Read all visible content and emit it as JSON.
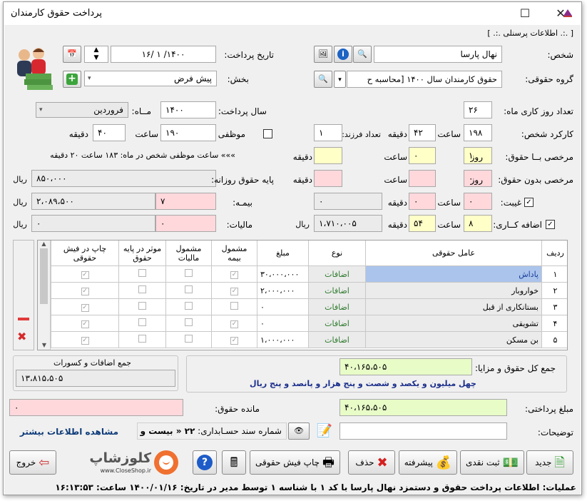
{
  "window": {
    "title": "پرداخت حقوق کارمندان"
  },
  "section": {
    "personnel_info": "[ .:. اطلاعات پرسنلی .:. ]"
  },
  "person": {
    "label": "شخص:",
    "value": "نهال پارسا"
  },
  "salary_group": {
    "label": "گروه حقوقی:",
    "value": "حقوق کارمندان سال ۱۴۰۰ [محاسبه ح"
  },
  "payment_date": {
    "label": "تاریخ پرداخت:",
    "value": "۱۴۰۰/ ۱ /۱۶"
  },
  "section_field": {
    "label": "بخش:",
    "value": "پیش فرض"
  },
  "work_days": {
    "label": "تعداد روز کاری ماه:",
    "value": "۲۶"
  },
  "pay_year": {
    "label": "سال پرداخت:",
    "value": "۱۴۰۰"
  },
  "month": {
    "label": "مــاه:",
    "value": "فروردین"
  },
  "mandatory": {
    "label": "موظفی ماه:",
    "hours": "۱۹۰",
    "hours_unit": "ساعت",
    "minutes": "۴۰",
    "minutes_unit": "دقیقه",
    "note": "»»» ساعت موظفی شخص در ماه: ۱۸۳ ساعت ۲۰ دقیقه"
  },
  "performance": {
    "label": "کارکرد شخص:",
    "hours": "۱۹۸",
    "hours_unit": "ساعت",
    "minutes": "۴۲",
    "minutes_unit": "دقیقه",
    "children_label": "تعداد فرزند:",
    "children": "۱"
  },
  "paid_leave": {
    "label": "مرخصی بــا حقوق:",
    "days": "۱",
    "days_unit": "روز",
    "hours": "۰",
    "hours_unit": "ساعت",
    "minutes": "",
    "minutes_unit": "دقیقه"
  },
  "unpaid_leave": {
    "label": "مرخصی بدون حقوق:",
    "days": "۰",
    "days_unit": "روز",
    "hours": "",
    "hours_unit": "ساعت",
    "minutes": "",
    "minutes_unit": "دقیقه"
  },
  "absence": {
    "label": "غیبت:",
    "hours": "۰",
    "hours_unit": "ساعت",
    "minutes": "۰",
    "minutes_unit": "دقیقه",
    "amount": "۰"
  },
  "overtime": {
    "label": "اضافه کــاری:",
    "hours": "۸",
    "hours_unit": "ساعت",
    "minutes": "۵۴",
    "minutes_unit": "دقیقه",
    "amount": "۱،۷۱۰،۰۰۵",
    "currency": "ریال"
  },
  "daily_base": {
    "label": "پایه حقوق روزانه:",
    "value": "۸۵۰،۰۰۰",
    "currency": "ریال"
  },
  "insurance": {
    "label": "بیمـه:",
    "percent": "۷",
    "amount": "۲،۰۸۹،۵۰۰",
    "currency": "ریال"
  },
  "tax": {
    "label": "مالیات:",
    "percent": "۰",
    "amount": "۰",
    "currency": "ریال"
  },
  "table": {
    "headers": [
      "ردیف",
      "عامل حقوقی",
      "نوع",
      "مبلغ",
      "مشمول بیمه",
      "مشمول مالیات",
      "موثر در پایه حقوق",
      "چاپ در فیش حقوقی"
    ],
    "rows": [
      {
        "row": "۱",
        "factor": "پاداش",
        "type": "اضافات",
        "amount": "۳۰،۰۰۰،۰۰۰",
        "insurance": true,
        "tax": false,
        "base": false,
        "print": true
      },
      {
        "row": "۲",
        "factor": "خواروبار",
        "type": "اضافات",
        "amount": "۲،۰۰۰،۰۰۰",
        "insurance": true,
        "tax": false,
        "base": false,
        "print": true
      },
      {
        "row": "۳",
        "factor": "بستانکاری از قبل",
        "type": "اضافات",
        "amount": "۰",
        "insurance": false,
        "tax": false,
        "base": false,
        "print": true
      },
      {
        "row": "۴",
        "factor": "تشویقی",
        "type": "اضافات",
        "amount": "۰",
        "insurance": true,
        "tax": false,
        "base": false,
        "print": true
      },
      {
        "row": "۵",
        "factor": "بن مسکن",
        "type": "اضافات",
        "amount": "۱،۰۰۰،۰۰۰",
        "insurance": true,
        "tax": false,
        "base": false,
        "print": true
      }
    ]
  },
  "totals": {
    "sum_label": "جمع اضافات و کسورات",
    "sum_value": "۱۳،۸۱۵،۵۰۵",
    "total_label": "جمع کل حقوق و مزایا:",
    "total_value": "۴۰،۱۶۵،۵۰۵",
    "total_words": "چهل میلیون و یکصد و شصت و پنج هزار و پانصد و پنج ریال",
    "remaining_label": "مانده حقوق:",
    "remaining_value": "۰",
    "paid_label": "مبلغ پرداختی:",
    "paid_value": "۴۰،۱۶۵،۵۰۵",
    "more_info": "مشاهده اطلاعات بیشتر",
    "voucher_label": "شماره سند حسـابداری:",
    "voucher_value": "۲۲ « بیست و د",
    "desc_label": "توضیحات:",
    "desc_value": ""
  },
  "buttons": {
    "new": "جدید",
    "cash": "ثبت نقدی",
    "advanced": "پیشرفته",
    "delete": "حذف",
    "print": "چاپ فیش حقوقی",
    "exit": "خروج"
  },
  "watermark": {
    "brand": "کلوزشاپ",
    "url": "www.CloseShop.ir"
  },
  "status": {
    "text": "عملیات: اطلاعات پرداخت حقوق و دستمزد نهال پارسا با کد ۱ با شناسه ۱ توسط مدیر در تاریخ: ۱۴۰۰/۰۱/۱۶ ساعت: ۱۶:۱۳:۵۳"
  },
  "colors": {
    "yellow": "#ffffc8",
    "green": "#e8fcc8",
    "pink": "#ffd8dc",
    "total_words": "#1b2f8c",
    "more_info": "#0f3c7a"
  }
}
